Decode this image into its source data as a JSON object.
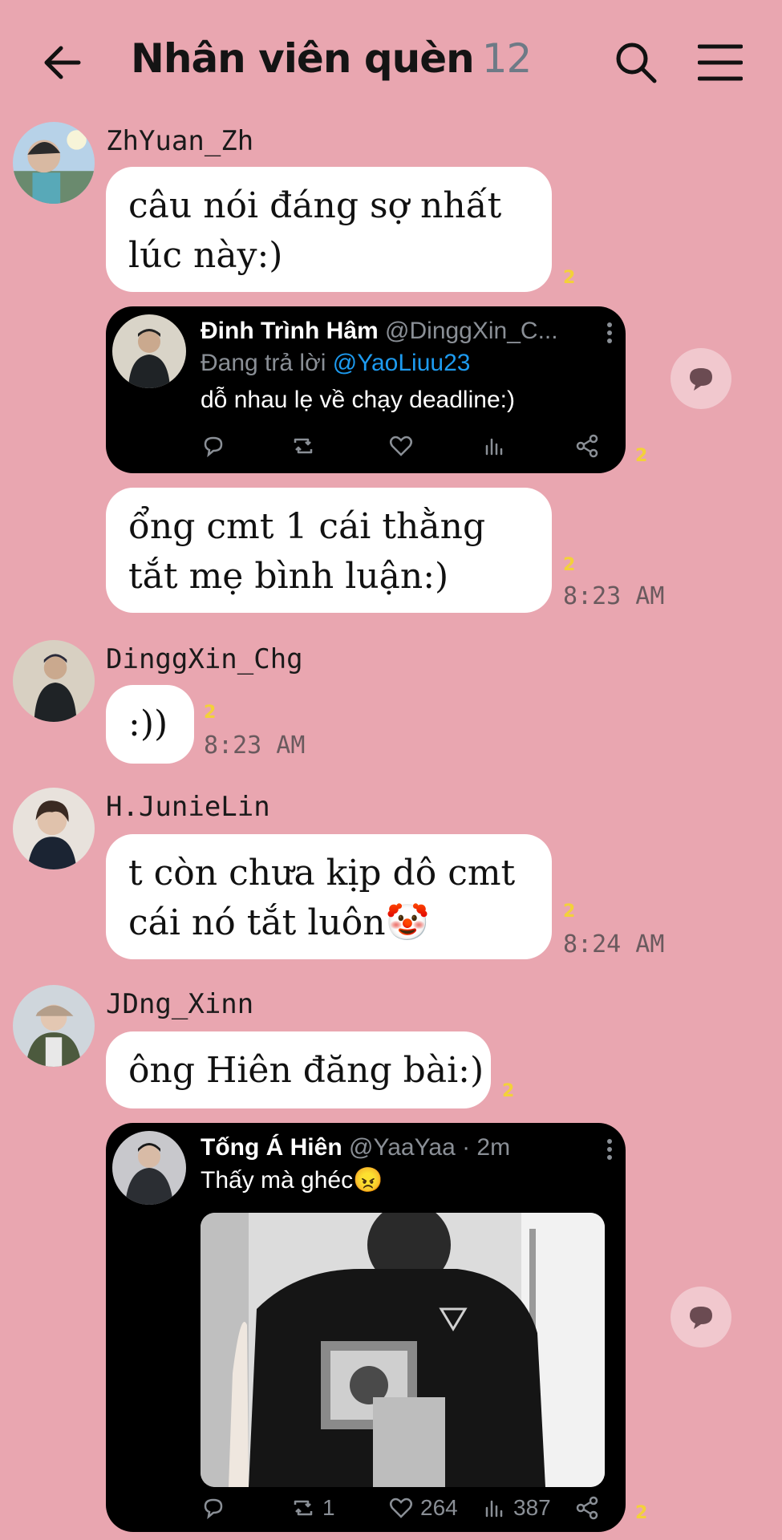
{
  "header": {
    "title": "Nhân viên quèn",
    "member_count": "12"
  },
  "messages": [
    {
      "sender": "ZhYuan_Zh",
      "bubble1_lines": [
        "câu nói đáng sợ nhất",
        "lúc này:)"
      ],
      "bubble1_read": "2",
      "tweet1": {
        "name": "Đinh Trình Hâm",
        "handle": "@DinggXin_C...",
        "reply_prefix": "Đang trả lời",
        "reply_to": "@YaoLiuu23",
        "text": "dỗ nhau lẹ về chạy deadline:)",
        "read": "2"
      },
      "bubble2_lines": [
        "ổng cmt 1 cái thằng",
        "tắt mẹ bình luận:)"
      ],
      "bubble2_read": "2",
      "time": "8:23 AM"
    },
    {
      "sender": "DinggXin_Chg",
      "text": ":))",
      "read": "2",
      "time": "8:23 AM"
    },
    {
      "sender": "H.JunieLin",
      "lines": [
        "t còn chưa kịp dô cmt",
        "cái nó tắt luôn🤡"
      ],
      "read": "2",
      "time": "8:24 AM"
    },
    {
      "sender": "JDng_Xinn",
      "text": "ông Hiên đăng bài:)",
      "read": "2",
      "tweet2": {
        "name": "Tống Á Hiên",
        "handle": "@YaaYaa · 2m",
        "text": "Thấy mà ghéc😠",
        "retweets": "1",
        "likes": "264",
        "views": "387",
        "read": "2"
      }
    }
  ],
  "colors": {
    "background": "#e9a6b0",
    "bubble": "#ffffff",
    "read_marker": "#f3d13a",
    "tweet_bg": "#000000",
    "mention": "#1d9bf0"
  },
  "icons": [
    "back-arrow-icon",
    "search-icon",
    "hamburger-menu-icon",
    "reply-icon",
    "retweet-icon",
    "like-icon",
    "views-icon",
    "share-icon",
    "more-vertical-icon",
    "comment-icon"
  ]
}
